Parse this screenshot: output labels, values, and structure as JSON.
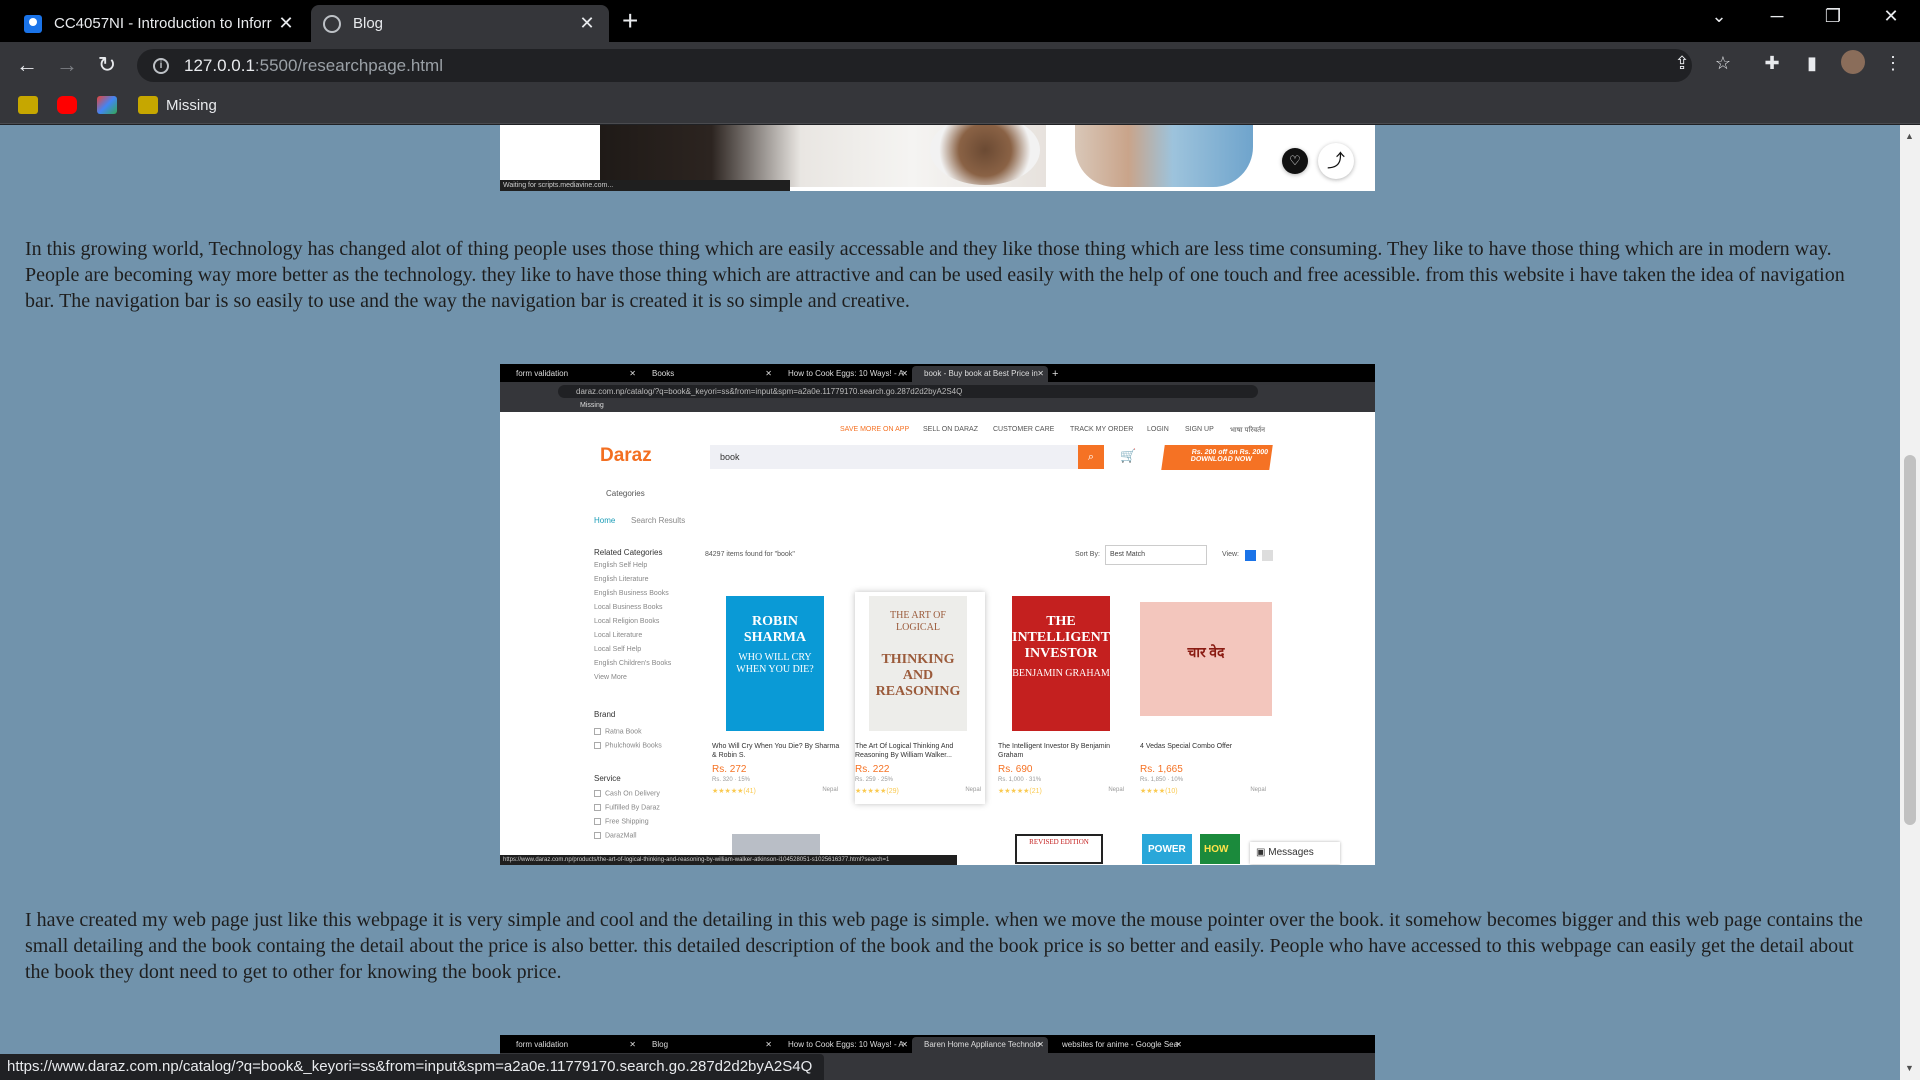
{
  "browser": {
    "tabs": [
      {
        "title": "CC4057NI - Introduction to Inforr",
        "close": "✕"
      },
      {
        "title": "Blog",
        "close": "✕"
      }
    ],
    "new_tab": "+",
    "window_controls": {
      "list": "⌄",
      "minimize": "─",
      "restore": "❐",
      "close": "✕"
    },
    "url_host": "127.0.0.1",
    "url_path": ":5500/researchpage.html",
    "bookmarks": {
      "missing_label": "Missing"
    },
    "status_url": "https://www.daraz.com.np/catalog/?q=book&_keyori=ss&from=input&spm=a2a0e.11779170.search.go.287d2d2byA2S4Q"
  },
  "page": {
    "paragraph1": "In this growing world, Technology has changed alot of thing people uses those thing which are easily accessable and they like those thing which are less time consuming. They like to have those thing which are in modern way. People are becoming way more better as the technology. they like to have those thing which are attractive and can be used easily with the help of one touch and free acessible. from this website i have taken the idea of navigation bar. The navigation bar is so easily to use and the way the navigation bar is created it is so simple and creative.",
    "paragraph2": "I have created my web page just like this webpage it is very simple and cool and the detailing in this web page is simple. when we move the mouse pointer over the book. it somehow becomes bigger and this web page contains the small detailing and the book containg the detail about the price is also better. this detailed description of the book and the book price is so better and easily. People who have accessed to this webpage can easily get the detail about the book they dont need to get to other for knowing the book price.",
    "shot1": {
      "status_text": "Waiting for scripts.mediavine.com..."
    },
    "shot2": {
      "tabs": [
        "form validation",
        "Books",
        "How to Cook Eggs: 10 Ways! - A",
        "book - Buy book at Best Price in"
      ],
      "url": "daraz.com.np/catalog/?q=book&_keyori=ss&from=input&spm=a2a0e.11779170.search.go.287d2d2byA2S4Q",
      "bookmark_label": "Missing",
      "top_links": [
        "SAVE MORE ON APP",
        "SELL ON DARAZ",
        "CUSTOMER CARE",
        "TRACK MY ORDER",
        "LOGIN",
        "SIGN UP",
        "भाषा परिवर्तन"
      ],
      "logo": "Daraz",
      "search_value": "book",
      "promo": "Rs. 200 off on Rs. 2000 DOWNLOAD NOW",
      "categories": "Categories",
      "breadcrumb_home": "Home",
      "breadcrumb_current": "Search Results",
      "related_title": "Related Categories",
      "related": [
        "English Self Help",
        "English Literature",
        "English Business Books",
        "Local Business Books",
        "Local Religion Books",
        "Local Literature",
        "Local Self Help",
        "English Children's Books"
      ],
      "view_more": "View More",
      "brand_title": "Brand",
      "brands": [
        "Ratna Book",
        "Phulchowki Books"
      ],
      "service_title": "Service",
      "services": [
        "Cash On Delivery",
        "Fulfilled By Daraz",
        "Free Shipping",
        "DarazMall"
      ],
      "results_count": "84297 items found for \"book\"",
      "sort_label": "Sort By:",
      "sort_value": "Best Match",
      "view_label": "View:",
      "products": [
        {
          "cover_title": "ROBIN SHARMA",
          "cover_sub": "WHO WILL CRY WHEN YOU DIE?",
          "name": "Who Will Cry When You Die? By Sharma & Robin S.",
          "price": "Rs. 272",
          "meta": "Rs. 320 · 15%",
          "stars": "★★★★★(41)",
          "loc": "Nepal"
        },
        {
          "cover_title": "THINKING AND REASONING",
          "cover_sub": "THE ART OF LOGICAL",
          "name": "The Art Of Logical Thinking And Reasoning By William Walker...",
          "price": "Rs. 222",
          "meta": "Rs. 259 · 25%",
          "stars": "★★★★★(29)",
          "loc": "Nepal"
        },
        {
          "cover_title": "THE INTELLIGENT INVESTOR",
          "cover_sub": "BENJAMIN GRAHAM",
          "name": "The Intelligent Investor By Benjamin Graham",
          "price": "Rs. 690",
          "meta": "Rs. 1,000 · 31%",
          "stars": "★★★★★(21)",
          "loc": "Nepal"
        },
        {
          "cover_title": "चार वेद",
          "cover_sub": "",
          "name": "4 Vedas Special Combo Offer",
          "price": "Rs. 1,665",
          "meta": "Rs. 1,850 · 10%",
          "stars": "★★★★(10)",
          "loc": "Nepal"
        }
      ],
      "bottom_covers": [
        "REVISED EDITION",
        "POWER",
        "HOW"
      ],
      "messages": "Messages",
      "status_text": "https://www.daraz.com.np/products/the-art-of-logical-thinking-and-reasoning-by-william-walker-atkinson-i104528051-s1025616377.html?search=1"
    },
    "shot3": {
      "tabs": [
        "form validation",
        "Blog",
        "How to Cook Eggs: 10 Ways! - A",
        "Baren Home Appliance Technolo",
        "websites for anime - Google Sea"
      ]
    }
  }
}
